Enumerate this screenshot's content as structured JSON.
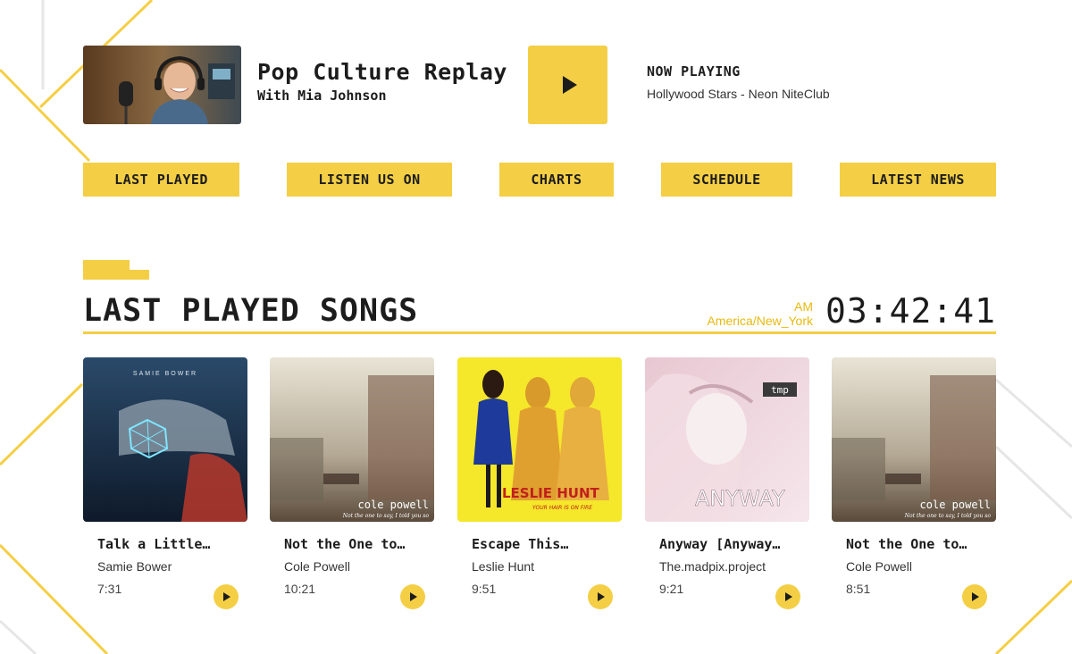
{
  "colors": {
    "accent": "#f4cf45",
    "accent_text": "#e8b90e",
    "text": "#1c1c1c"
  },
  "header": {
    "show_title": "Pop Culture Replay",
    "show_host": "With Mia Johnson",
    "play_icon": "play-icon",
    "now_playing_label": "NOW PLAYING",
    "now_playing_track": "Hollywood Stars - Neon NiteClub"
  },
  "nav": [
    {
      "label": "LAST PLAYED"
    },
    {
      "label": "LISTEN US ON"
    },
    {
      "label": "CHARTS"
    },
    {
      "label": "SCHEDULE"
    },
    {
      "label": "LATEST NEWS"
    }
  ],
  "section": {
    "title": "LAST PLAYED SONGS",
    "ampm": "AM",
    "timezone": "America/New_York",
    "clock": "03:42:41"
  },
  "songs": [
    {
      "title": "Talk a Little…",
      "artist": "Samie Bower",
      "duration": "7:31",
      "cover_text": "SAMIE BOWER"
    },
    {
      "title": "Not the One to…",
      "artist": "Cole Powell",
      "duration": "10:21",
      "cover_text": "cole powell",
      "cover_subtext": "Not the one to say, I told you so"
    },
    {
      "title": "Escape This…",
      "artist": "Leslie Hunt",
      "duration": "9:51",
      "cover_text": "LESLIE HUNT",
      "cover_subtext": "YOUR HAIR IS ON FIRE"
    },
    {
      "title": "Anyway [Anyway…",
      "artist": "The.madpix.project",
      "duration": "9:21",
      "cover_text": "ANYWAY",
      "cover_badge": "tmp"
    },
    {
      "title": "Not the One to…",
      "artist": "Cole Powell",
      "duration": "8:51",
      "cover_text": "cole powell",
      "cover_subtext": "Not the one to say, I told you so"
    }
  ]
}
